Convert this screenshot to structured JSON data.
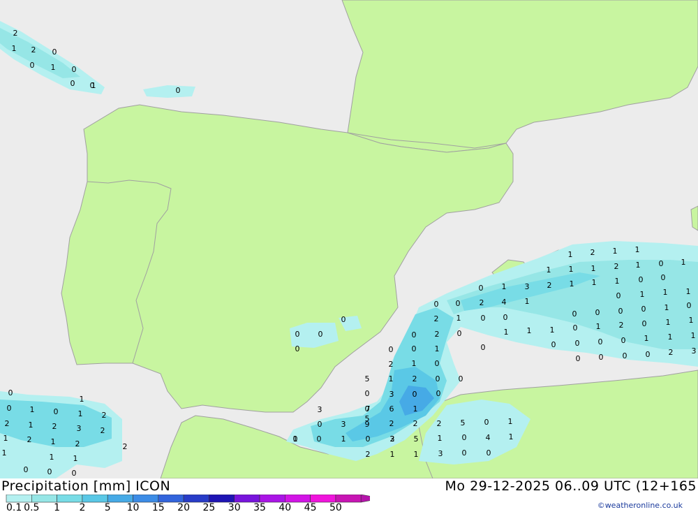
{
  "header": {
    "left_title": "Precipitation [mm] ICON",
    "right_title": "Mo 29-12-2025 06..09 UTC (12+165",
    "credit": "©weatheronline.co.uk"
  },
  "legend": {
    "labels": [
      "0.1",
      "0.5",
      "1",
      "2",
      "5",
      "10",
      "15",
      "20",
      "25",
      "30",
      "35",
      "40",
      "45",
      "50"
    ],
    "colors": [
      "#b4f0f0",
      "#96e6e6",
      "#78dce6",
      "#5ac8e6",
      "#46aae6",
      "#3c8ce6",
      "#3264dc",
      "#283cc8",
      "#1e14b4",
      "#7814dc",
      "#aa14e6",
      "#d214e6",
      "#f014dc",
      "#c814b4"
    ]
  },
  "colors": {
    "sea": "#ececec",
    "land": "#c8f5a0",
    "border": "#a0a0a0"
  },
  "map_values": [
    "2",
    "1",
    "2",
    "0",
    "0",
    "1",
    "0",
    "0",
    "1",
    "0",
    "0",
    "0",
    "0",
    "0",
    "0",
    "1",
    "2",
    "1",
    "1",
    "1",
    "2",
    "1",
    "0",
    "1",
    "1",
    "1",
    "2",
    "1",
    "0",
    "0",
    "1",
    "3",
    "2",
    "1",
    "1",
    "0",
    "0",
    "0",
    "1",
    "1",
    "4",
    "1",
    "0",
    "0",
    "1",
    "0",
    "0",
    "0",
    "1",
    "0",
    "1",
    "1",
    "0",
    "1",
    "1",
    "0",
    "0",
    "1",
    "1",
    "2",
    "0",
    "0",
    "0",
    "0",
    "1",
    "0",
    "1",
    "0",
    "0",
    "0",
    "0",
    "0",
    "1",
    "1",
    "0",
    "0",
    "0",
    "0",
    "2",
    "3",
    "0",
    "1",
    "0",
    "0",
    "2",
    "1",
    "2",
    "0",
    "0",
    "2",
    "1",
    "0",
    "1",
    "2",
    "0",
    "5",
    "5",
    "3",
    "0",
    "0",
    "3",
    "7",
    "6",
    "1",
    "0",
    "3",
    "9",
    "2",
    "2",
    "2",
    "5",
    "3",
    "1",
    "1",
    "0",
    "1",
    "0",
    "2",
    "5",
    "1",
    "0",
    "4",
    "3",
    "2",
    "1",
    "1",
    "0",
    "0",
    "0",
    "1",
    "1",
    "1",
    "0",
    "2",
    "1",
    "2",
    "3",
    "2",
    "2",
    "1",
    "2",
    "1",
    "2",
    "2",
    "1",
    "1",
    "1",
    "0",
    "0",
    "0",
    "0",
    "0",
    "0",
    "0",
    "0"
  ]
}
